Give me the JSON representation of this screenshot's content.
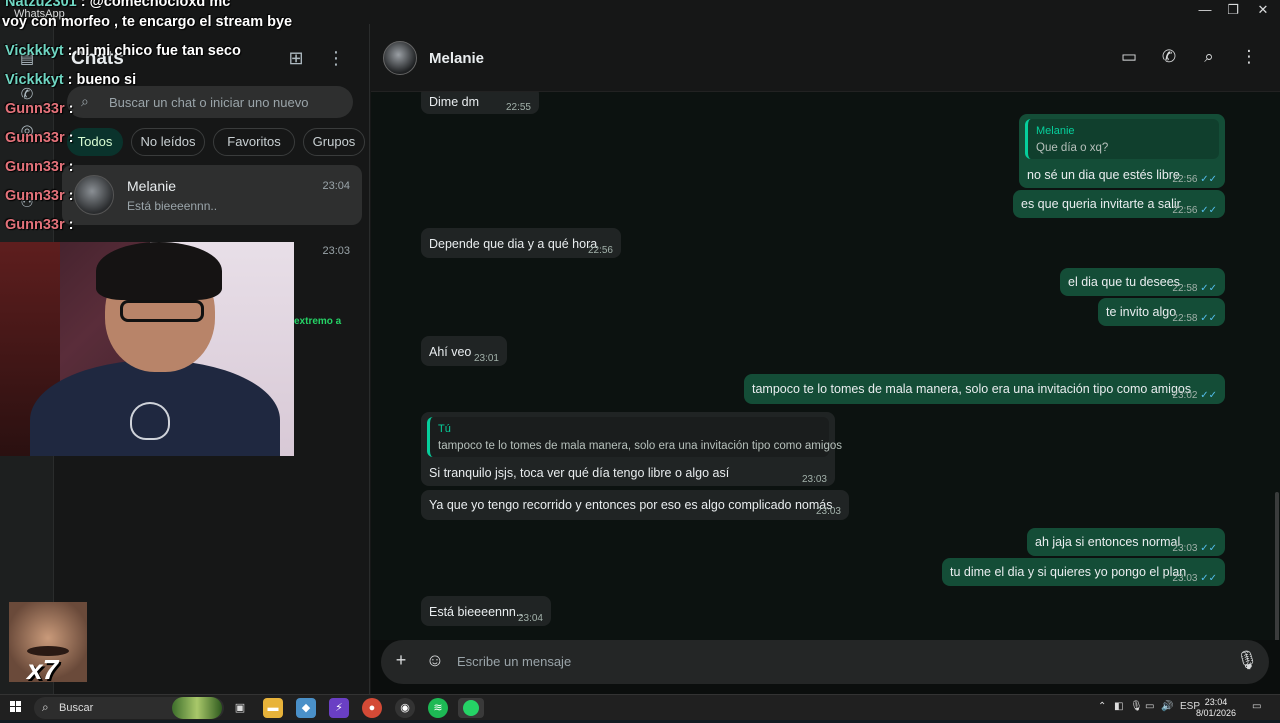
{
  "window": {
    "app_name": "WhatsApp",
    "minimize": "—",
    "maximize": "❐",
    "close": "✕"
  },
  "sidebar": {
    "title": "Chats",
    "new_chat_icon": "new-chat-icon",
    "menu_icon": "more-vert-icon",
    "search_placeholder": "Buscar un chat o iniciar uno nuevo",
    "filters": [
      "Todos",
      "No leídos",
      "Favoritos",
      "Grupos"
    ],
    "chats": [
      {
        "name": "Melanie",
        "preview": "Está bieeeennn..",
        "time": "23:04",
        "selected": true
      },
      {
        "name": "",
        "preview": "",
        "time": "23:03",
        "selected": false
      }
    ],
    "partial_text": "extremo a"
  },
  "conversation": {
    "contact_name": "Melanie",
    "composer_placeholder": "Escribe un mensaje",
    "messages": [
      {
        "dir": "in",
        "text": "Dime dm",
        "time": "22:55"
      },
      {
        "dir": "out",
        "quote_name": "Melanie",
        "quote_text": "Que día o xq?",
        "text": "no sé un dia que estés libre",
        "time": "22:56"
      },
      {
        "dir": "out",
        "text": "es que queria invitarte a salir",
        "time": "22:56"
      },
      {
        "dir": "in",
        "text": "Depende que dia y a qué hora",
        "time": "22:56"
      },
      {
        "dir": "out",
        "text": "el dia que tu desees",
        "time": "22:58"
      },
      {
        "dir": "out",
        "text": "te invito algo",
        "time": "22:58"
      },
      {
        "dir": "in",
        "text": "Ahí veo",
        "time": "23:01"
      },
      {
        "dir": "out",
        "text": "tampoco te lo tomes de mala manera, solo era una invitación tipo como amigos",
        "time": "23:02"
      },
      {
        "dir": "in",
        "quote_name": "Tú",
        "quote_text": "tampoco te lo tomes de mala manera, solo era una invitación tipo como amigos",
        "text": "Si tranquilo jsjs, toca ver qué día tengo libre o algo así",
        "time": "23:03"
      },
      {
        "dir": "in",
        "text": "Ya que yo tengo recorrido y entonces por eso es algo complicado nomás",
        "time": "23:03"
      },
      {
        "dir": "out",
        "text": "ah jaja si entonces normal",
        "time": "23:03"
      },
      {
        "dir": "out",
        "text": "tu dime el dia y si quieres yo pongo el plan",
        "time": "23:03"
      },
      {
        "dir": "in",
        "text": "Está bieeeennn..",
        "time": "23:04"
      }
    ]
  },
  "stream_chat": [
    {
      "user": "Natzu2301",
      "text": ": @comechocloxd mc",
      "color": "teal"
    },
    {
      "user": "",
      "text": "voy con morfeo , te encargo el stream bye",
      "color": "white"
    },
    {
      "user": "Vickkkyt",
      "text": ": ni mi chico fue tan seco",
      "color": "teal"
    },
    {
      "user": "Vickkkyt",
      "text": ": bueno si",
      "color": "teal"
    },
    {
      "user": "Gunn33r",
      "text": ":",
      "color": "red"
    },
    {
      "user": "Gunn33r",
      "text": ":",
      "color": "red"
    },
    {
      "user": "Gunn33r",
      "text": ":",
      "color": "red"
    },
    {
      "user": "Gunn33r",
      "text": ":",
      "color": "red"
    },
    {
      "user": "Gunn33r",
      "text": ":",
      "color": "red"
    }
  ],
  "face_cam_label": "x7",
  "taskbar": {
    "search_label": "Buscar",
    "lang": "ESP",
    "time": "23:04",
    "date": "8/01/2026"
  },
  "colors": {
    "accent": "#06cf9c",
    "out_bubble": "#144d37",
    "in_bubble": "#202424"
  }
}
